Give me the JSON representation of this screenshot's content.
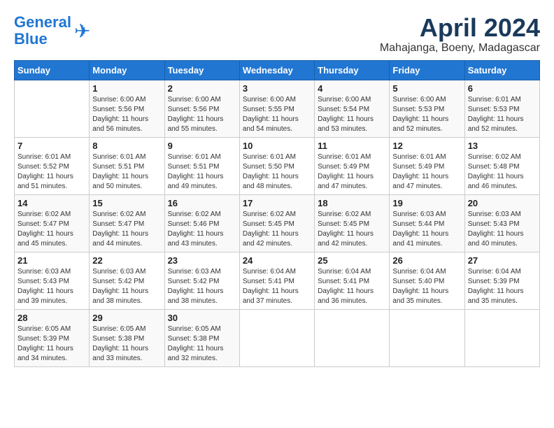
{
  "logo": {
    "line1": "General",
    "line2": "Blue"
  },
  "title": "April 2024",
  "location": "Mahajanga, Boeny, Madagascar",
  "headers": [
    "Sunday",
    "Monday",
    "Tuesday",
    "Wednesday",
    "Thursday",
    "Friday",
    "Saturday"
  ],
  "weeks": [
    [
      {
        "day": "",
        "info": ""
      },
      {
        "day": "1",
        "info": "Sunrise: 6:00 AM\nSunset: 5:56 PM\nDaylight: 11 hours\nand 56 minutes."
      },
      {
        "day": "2",
        "info": "Sunrise: 6:00 AM\nSunset: 5:56 PM\nDaylight: 11 hours\nand 55 minutes."
      },
      {
        "day": "3",
        "info": "Sunrise: 6:00 AM\nSunset: 5:55 PM\nDaylight: 11 hours\nand 54 minutes."
      },
      {
        "day": "4",
        "info": "Sunrise: 6:00 AM\nSunset: 5:54 PM\nDaylight: 11 hours\nand 53 minutes."
      },
      {
        "day": "5",
        "info": "Sunrise: 6:00 AM\nSunset: 5:53 PM\nDaylight: 11 hours\nand 52 minutes."
      },
      {
        "day": "6",
        "info": "Sunrise: 6:01 AM\nSunset: 5:53 PM\nDaylight: 11 hours\nand 52 minutes."
      }
    ],
    [
      {
        "day": "7",
        "info": "Sunrise: 6:01 AM\nSunset: 5:52 PM\nDaylight: 11 hours\nand 51 minutes."
      },
      {
        "day": "8",
        "info": "Sunrise: 6:01 AM\nSunset: 5:51 PM\nDaylight: 11 hours\nand 50 minutes."
      },
      {
        "day": "9",
        "info": "Sunrise: 6:01 AM\nSunset: 5:51 PM\nDaylight: 11 hours\nand 49 minutes."
      },
      {
        "day": "10",
        "info": "Sunrise: 6:01 AM\nSunset: 5:50 PM\nDaylight: 11 hours\nand 48 minutes."
      },
      {
        "day": "11",
        "info": "Sunrise: 6:01 AM\nSunset: 5:49 PM\nDaylight: 11 hours\nand 47 minutes."
      },
      {
        "day": "12",
        "info": "Sunrise: 6:01 AM\nSunset: 5:49 PM\nDaylight: 11 hours\nand 47 minutes."
      },
      {
        "day": "13",
        "info": "Sunrise: 6:02 AM\nSunset: 5:48 PM\nDaylight: 11 hours\nand 46 minutes."
      }
    ],
    [
      {
        "day": "14",
        "info": "Sunrise: 6:02 AM\nSunset: 5:47 PM\nDaylight: 11 hours\nand 45 minutes."
      },
      {
        "day": "15",
        "info": "Sunrise: 6:02 AM\nSunset: 5:47 PM\nDaylight: 11 hours\nand 44 minutes."
      },
      {
        "day": "16",
        "info": "Sunrise: 6:02 AM\nSunset: 5:46 PM\nDaylight: 11 hours\nand 43 minutes."
      },
      {
        "day": "17",
        "info": "Sunrise: 6:02 AM\nSunset: 5:45 PM\nDaylight: 11 hours\nand 42 minutes."
      },
      {
        "day": "18",
        "info": "Sunrise: 6:02 AM\nSunset: 5:45 PM\nDaylight: 11 hours\nand 42 minutes."
      },
      {
        "day": "19",
        "info": "Sunrise: 6:03 AM\nSunset: 5:44 PM\nDaylight: 11 hours\nand 41 minutes."
      },
      {
        "day": "20",
        "info": "Sunrise: 6:03 AM\nSunset: 5:43 PM\nDaylight: 11 hours\nand 40 minutes."
      }
    ],
    [
      {
        "day": "21",
        "info": "Sunrise: 6:03 AM\nSunset: 5:43 PM\nDaylight: 11 hours\nand 39 minutes."
      },
      {
        "day": "22",
        "info": "Sunrise: 6:03 AM\nSunset: 5:42 PM\nDaylight: 11 hours\nand 38 minutes."
      },
      {
        "day": "23",
        "info": "Sunrise: 6:03 AM\nSunset: 5:42 PM\nDaylight: 11 hours\nand 38 minutes."
      },
      {
        "day": "24",
        "info": "Sunrise: 6:04 AM\nSunset: 5:41 PM\nDaylight: 11 hours\nand 37 minutes."
      },
      {
        "day": "25",
        "info": "Sunrise: 6:04 AM\nSunset: 5:41 PM\nDaylight: 11 hours\nand 36 minutes."
      },
      {
        "day": "26",
        "info": "Sunrise: 6:04 AM\nSunset: 5:40 PM\nDaylight: 11 hours\nand 35 minutes."
      },
      {
        "day": "27",
        "info": "Sunrise: 6:04 AM\nSunset: 5:39 PM\nDaylight: 11 hours\nand 35 minutes."
      }
    ],
    [
      {
        "day": "28",
        "info": "Sunrise: 6:05 AM\nSunset: 5:39 PM\nDaylight: 11 hours\nand 34 minutes."
      },
      {
        "day": "29",
        "info": "Sunrise: 6:05 AM\nSunset: 5:38 PM\nDaylight: 11 hours\nand 33 minutes."
      },
      {
        "day": "30",
        "info": "Sunrise: 6:05 AM\nSunset: 5:38 PM\nDaylight: 11 hours\nand 32 minutes."
      },
      {
        "day": "",
        "info": ""
      },
      {
        "day": "",
        "info": ""
      },
      {
        "day": "",
        "info": ""
      },
      {
        "day": "",
        "info": ""
      }
    ]
  ]
}
